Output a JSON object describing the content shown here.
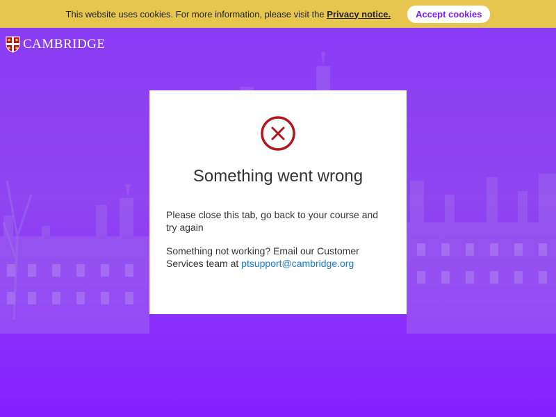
{
  "cookie_bar": {
    "text": "This website uses cookies. For more information, please visit the",
    "privacy_link": "Privacy notice.",
    "accept_label": "Accept cookies"
  },
  "logo": {
    "text": "CAMBRIDGE"
  },
  "error": {
    "title": "Something went wrong",
    "message1": "Please close this tab, go back to your course and try again",
    "message2_prefix": "Something not working? Email our Customer Services team at",
    "email": "ptsupport@cambridge.org",
    "icon": "error-x-circle-icon",
    "icon_color": "#b2161b"
  },
  "colors": {
    "cookie_bar": "#e6c64f",
    "background": "#8a2bff",
    "accent": "#7c1cff",
    "link": "#1779d4"
  }
}
